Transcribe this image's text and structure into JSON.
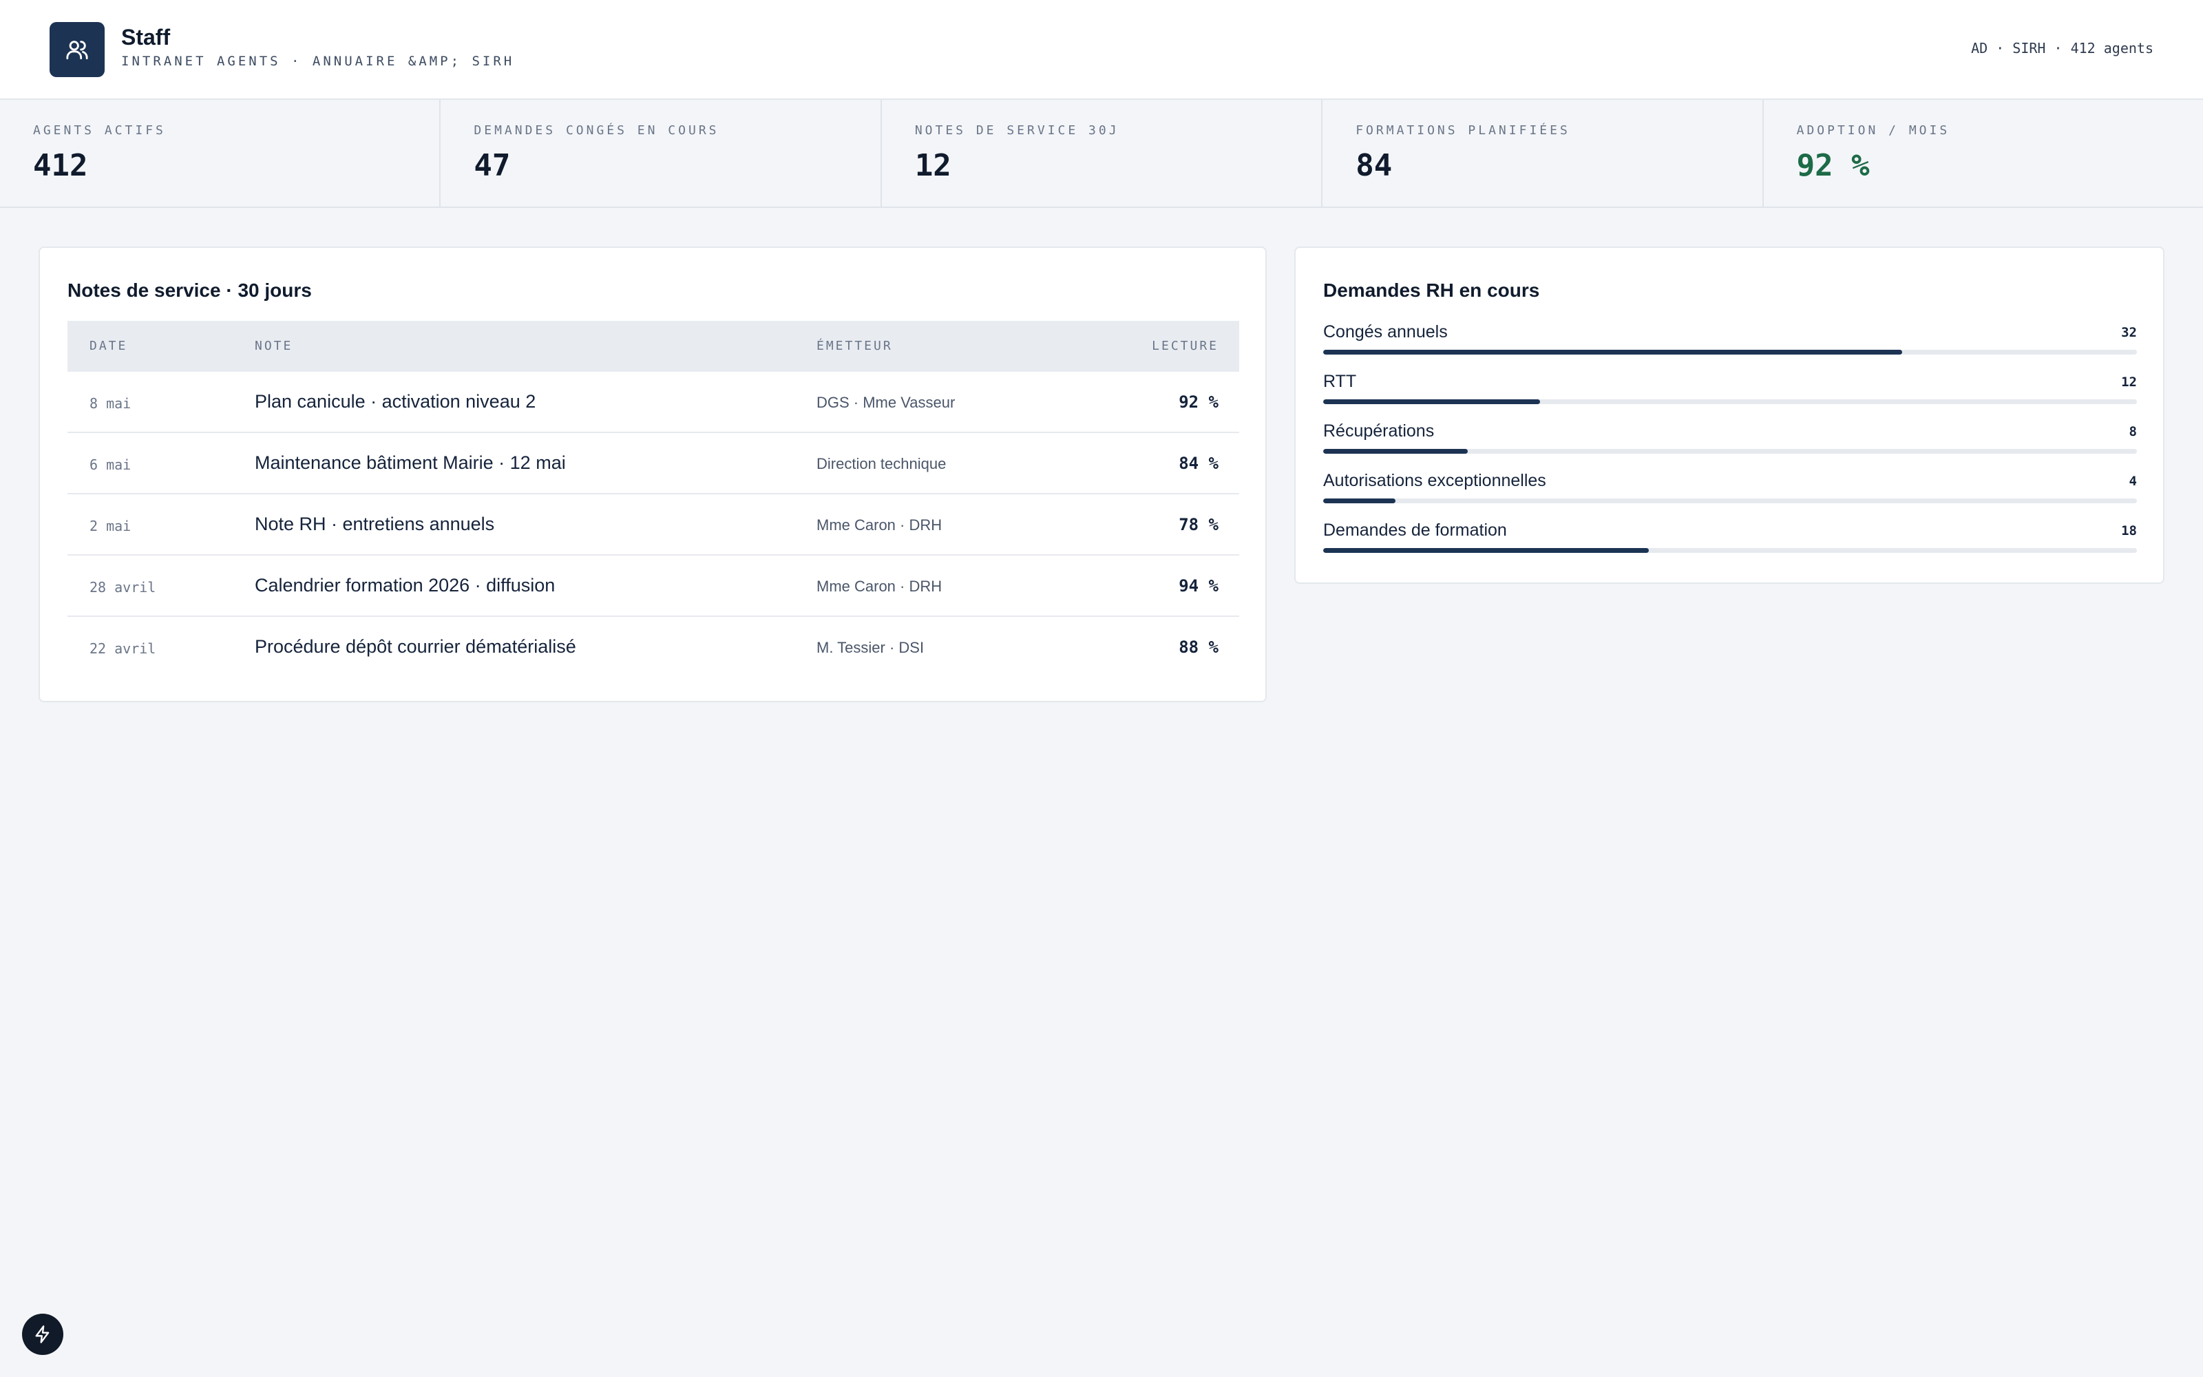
{
  "header": {
    "title": "Staff",
    "subtitle": "INTRANET AGENTS · ANNUAIRE &AMP; SIRH",
    "meta": "AD · SIRH · 412 agents",
    "logo_icon": "users-icon"
  },
  "kpis": [
    {
      "label": "AGENTS ACTIFS",
      "value": "412"
    },
    {
      "label": "DEMANDES CONGÉS EN COURS",
      "value": "47"
    },
    {
      "label": "NOTES DE SERVICE 30J",
      "value": "12"
    },
    {
      "label": "FORMATIONS PLANIFIÉES",
      "value": "84"
    },
    {
      "label": "ADOPTION / MOIS",
      "value": "92 %",
      "color": "#1d6b47"
    }
  ],
  "notes": {
    "title": "Notes de service · 30 jours",
    "columns": {
      "date": "DATE",
      "note": "NOTE",
      "emetteur": "ÉMETTEUR",
      "lecture": "LECTURE"
    },
    "rows": [
      {
        "date": "8 mai",
        "note": "Plan canicule · activation niveau 2",
        "emetteur": "DGS · Mme Vasseur",
        "lecture": "92 %"
      },
      {
        "date": "6 mai",
        "note": "Maintenance bâtiment Mairie · 12 mai",
        "emetteur": "Direction technique",
        "lecture": "84 %"
      },
      {
        "date": "2 mai",
        "note": "Note RH · entretiens annuels",
        "emetteur": "Mme Caron · DRH",
        "lecture": "78 %"
      },
      {
        "date": "28 avril",
        "note": "Calendrier formation 2026 · diffusion",
        "emetteur": "Mme Caron · DRH",
        "lecture": "94 %"
      },
      {
        "date": "22 avril",
        "note": "Procédure dépôt courrier dématérialisé",
        "emetteur": "M. Tessier · DSI",
        "lecture": "88 %"
      }
    ]
  },
  "rh": {
    "title": "Demandes RH en cours",
    "bar_color": "#1c3353",
    "bar_max": 45,
    "items": [
      {
        "label": "Congés annuels",
        "count": 32
      },
      {
        "label": "RTT",
        "count": 12
      },
      {
        "label": "Récupérations",
        "count": 8
      },
      {
        "label": "Autorisations exceptionnelles",
        "count": 4
      },
      {
        "label": "Demandes de formation",
        "count": 18
      }
    ]
  },
  "fab": {
    "icon": "bolt-icon"
  }
}
